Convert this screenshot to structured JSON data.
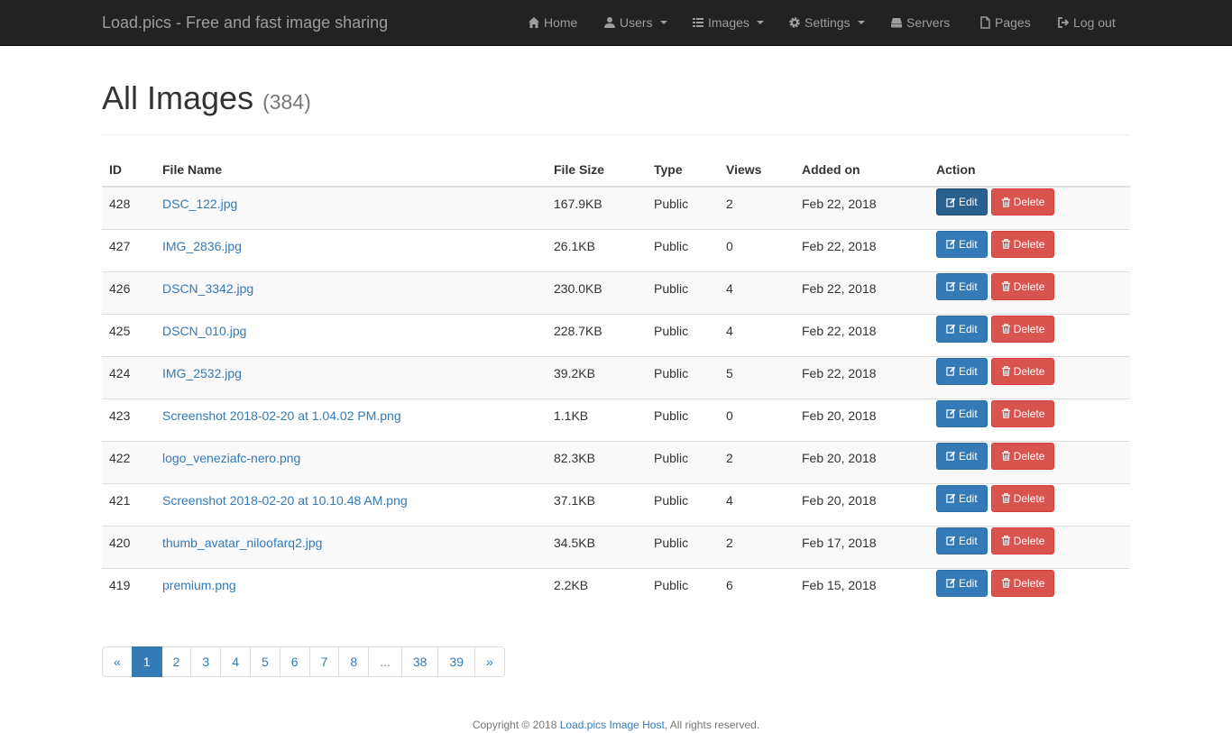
{
  "navbar": {
    "brand": "Load.pics - Free and fast image sharing",
    "items": [
      {
        "label": "Home",
        "icon": "home-icon",
        "dropdown": false
      },
      {
        "label": "Users",
        "icon": "user-icon",
        "dropdown": true
      },
      {
        "label": "Images",
        "icon": "list-icon",
        "dropdown": true
      },
      {
        "label": "Settings",
        "icon": "gear-icon",
        "dropdown": true
      },
      {
        "label": "Servers",
        "icon": "hdd-icon",
        "dropdown": false
      },
      {
        "label": "Pages",
        "icon": "file-icon",
        "dropdown": false
      },
      {
        "label": "Log out",
        "icon": "logout-icon",
        "dropdown": false
      }
    ]
  },
  "page": {
    "title": "All Images",
    "count": "(384)"
  },
  "table": {
    "headers": [
      "ID",
      "File Name",
      "File Size",
      "Type",
      "Views",
      "Added on",
      "Action"
    ],
    "edit_label": "Edit",
    "delete_label": "Delete",
    "rows": [
      {
        "id": "428",
        "name": "DSC_122.jpg",
        "size": "167.9KB",
        "type": "Public",
        "views": "2",
        "added": "Feb 22, 2018"
      },
      {
        "id": "427",
        "name": "IMG_2836.jpg",
        "size": "26.1KB",
        "type": "Public",
        "views": "0",
        "added": "Feb 22, 2018"
      },
      {
        "id": "426",
        "name": "DSCN_3342.jpg",
        "size": "230.0KB",
        "type": "Public",
        "views": "4",
        "added": "Feb 22, 2018"
      },
      {
        "id": "425",
        "name": "DSCN_010.jpg",
        "size": "228.7KB",
        "type": "Public",
        "views": "4",
        "added": "Feb 22, 2018"
      },
      {
        "id": "424",
        "name": "IMG_2532.jpg",
        "size": "39.2KB",
        "type": "Public",
        "views": "5",
        "added": "Feb 22, 2018"
      },
      {
        "id": "423",
        "name": "Screenshot 2018-02-20 at 1.04.02 PM.png",
        "size": "1.1KB",
        "type": "Public",
        "views": "0",
        "added": "Feb 20, 2018"
      },
      {
        "id": "422",
        "name": "logo_veneziafc-nero.png",
        "size": "82.3KB",
        "type": "Public",
        "views": "2",
        "added": "Feb 20, 2018"
      },
      {
        "id": "421",
        "name": "Screenshot 2018-02-20 at 10.10.48 AM.png",
        "size": "37.1KB",
        "type": "Public",
        "views": "4",
        "added": "Feb 20, 2018"
      },
      {
        "id": "420",
        "name": "thumb_avatar_niloofarq2.jpg",
        "size": "34.5KB",
        "type": "Public",
        "views": "2",
        "added": "Feb 17, 2018"
      },
      {
        "id": "419",
        "name": "premium.png",
        "size": "2.2KB",
        "type": "Public",
        "views": "6",
        "added": "Feb 15, 2018"
      }
    ]
  },
  "pagination": {
    "items": [
      "«",
      "1",
      "2",
      "3",
      "4",
      "5",
      "6",
      "7",
      "8",
      "...",
      "38",
      "39",
      "»"
    ],
    "active": "1"
  },
  "footer": {
    "prefix": "Copyright © 2018 ",
    "link": "Load.pics Image Host",
    "suffix": ", All rights reserved."
  },
  "colors": {
    "navbar_bg": "#222222",
    "nav_text": "#9d9d9d",
    "link": "#337ab7",
    "edit_button": "#337ab7",
    "delete_button": "#d9534f"
  }
}
